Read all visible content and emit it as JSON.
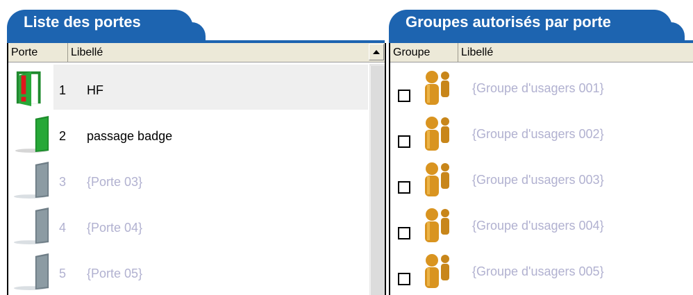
{
  "left_panel": {
    "title": "Liste des portes",
    "columns": [
      "Porte",
      "Libellé"
    ],
    "rows": [
      {
        "number": "1",
        "label": "HF",
        "state": "alarm",
        "selected": true
      },
      {
        "number": "2",
        "label": "passage badge",
        "state": "active",
        "selected": false
      },
      {
        "number": "3",
        "label": "{Porte 03}",
        "state": "inactive",
        "selected": false
      },
      {
        "number": "4",
        "label": "{Porte 04}",
        "state": "inactive",
        "selected": false
      },
      {
        "number": "5",
        "label": "{Porte 05}",
        "state": "inactive",
        "selected": false
      }
    ]
  },
  "right_panel": {
    "title": "Groupes autorisés par porte",
    "columns": [
      "Groupe",
      "Libellé"
    ],
    "rows": [
      {
        "label": "{Groupe d'usagers 001}",
        "checked": false
      },
      {
        "label": "{Groupe d'usagers 002}",
        "checked": false
      },
      {
        "label": "{Groupe d'usagers 003}",
        "checked": false
      },
      {
        "label": "{Groupe d'usagers 004}",
        "checked": false
      },
      {
        "label": "{Groupe d'usagers 005}",
        "checked": false
      }
    ]
  },
  "icons": {
    "door_alarm": "door-open-alarm-icon",
    "door_active": "door-green-icon",
    "door_inactive": "door-grey-icon",
    "group": "user-group-icon",
    "sort": "sort-up-icon"
  },
  "colors": {
    "tab_blue": "#1d64b0",
    "header_bg": "#ece9d8",
    "selected_row": "#efefef",
    "disabled_text": "#b1b1d0",
    "door_green": "#27a838",
    "door_grey": "#8c9ba3",
    "alarm_red": "#e0161d",
    "group_gold": "#c8861a"
  }
}
